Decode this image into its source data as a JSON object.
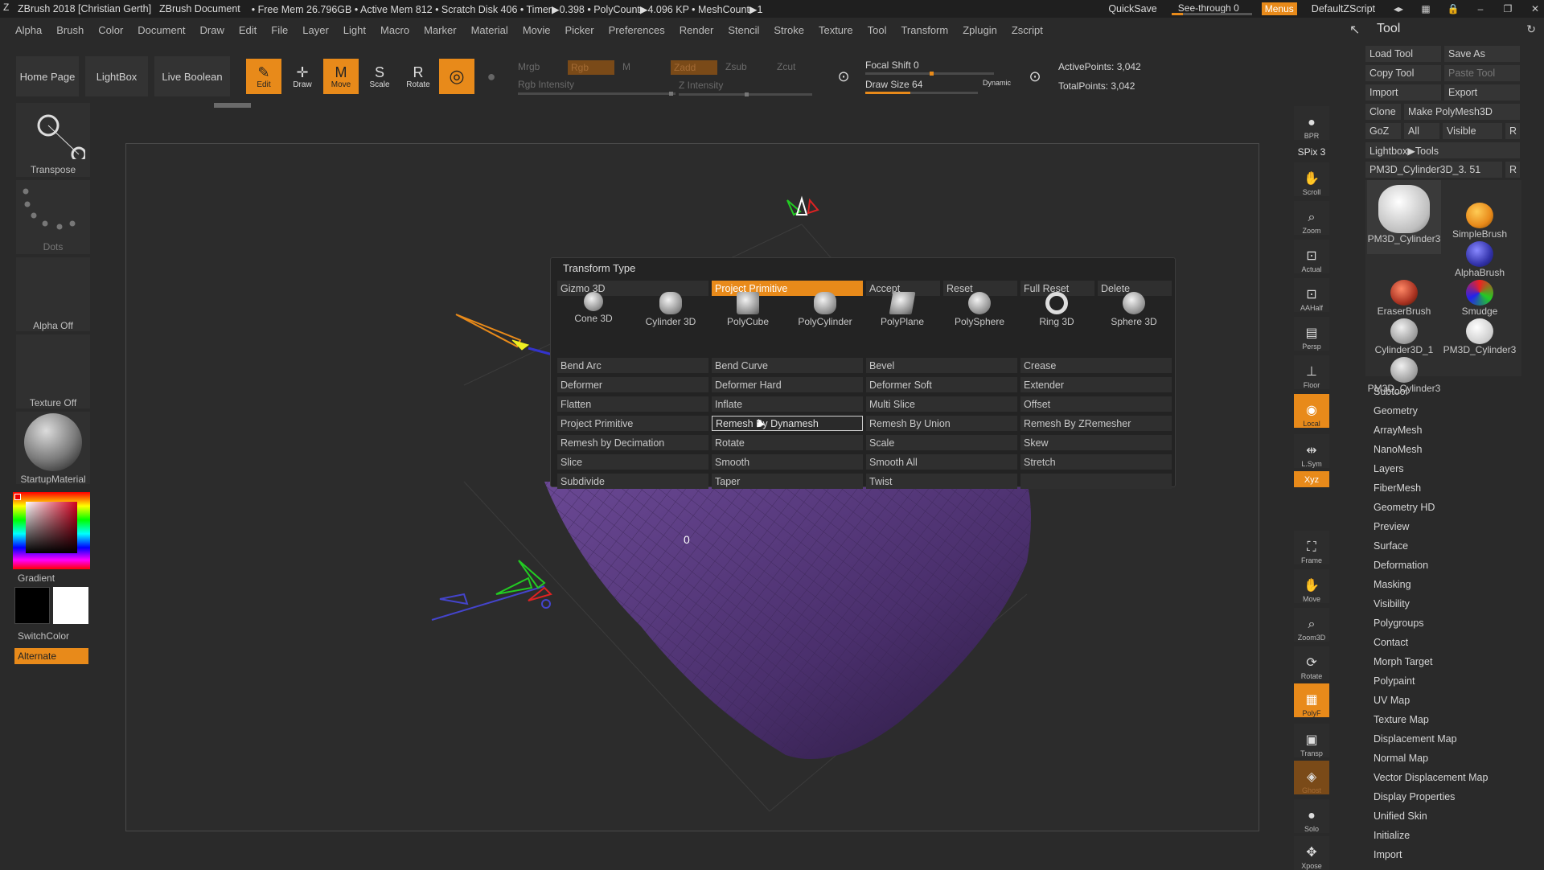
{
  "titlebar": {
    "title": "ZBrush 2018 [Christian Gerth]",
    "document": "ZBrush Document",
    "stats": "• Free Mem 26.796GB • Active Mem 812 • Scratch Disk 406 • Timer▶0.398 • PolyCount▶4.096 KP • MeshCount▶1",
    "quicksave": "QuickSave",
    "seethrough": "See-through  0",
    "menus": "Menus",
    "zscript": "DefaultZScript"
  },
  "menubar": [
    "Alpha",
    "Brush",
    "Color",
    "Document",
    "Draw",
    "Edit",
    "File",
    "Layer",
    "Light",
    "Macro",
    "Marker",
    "Material",
    "Movie",
    "Picker",
    "Preferences",
    "Render",
    "Stencil",
    "Stroke",
    "Texture",
    "Tool",
    "Transform",
    "Zplugin",
    "Zscript"
  ],
  "toolbar": {
    "home": "Home Page",
    "lightbox": "LightBox",
    "liveboolean": "Live Boolean",
    "edit": "Edit",
    "draw": "Draw",
    "move": "Move",
    "scale": "Scale",
    "rotate": "Rotate",
    "mrgb": "Mrgb",
    "rgb": "Rgb",
    "m": "M",
    "zadd": "Zadd",
    "zsub": "Zsub",
    "zcut": "Zcut",
    "rgb_intensity": "Rgb Intensity",
    "z_intensity": "Z Intensity",
    "focal_shift": "Focal Shift 0",
    "draw_size": "Draw Size 64",
    "dynamic": "Dynamic",
    "active_points": "ActivePoints: 3,042",
    "total_points": "TotalPoints: 3,042"
  },
  "left_shelf": {
    "transpose": "Transpose",
    "dots": "Dots",
    "alpha": "Alpha Off",
    "texture": "Texture Off",
    "material": "StartupMaterial",
    "gradient": "Gradient",
    "switchcolor": "SwitchColor",
    "alternate": "Alternate"
  },
  "viewport": {
    "label_zero": "0"
  },
  "popup": {
    "title": "Transform Type",
    "header": [
      "Gizmo 3D",
      "Project Primitive",
      "Accept",
      "Reset",
      "Full Reset",
      "Delete"
    ],
    "primitives": [
      "Cone 3D",
      "Cylinder 3D",
      "PolyCube",
      "PolyCylinder",
      "PolyPlane",
      "PolySphere",
      "Ring 3D",
      "Sphere 3D"
    ],
    "rows": [
      [
        "Bend Arc",
        "Bend Curve",
        "Bevel",
        "Crease"
      ],
      [
        "Deformer",
        "Deformer Hard",
        "Deformer Soft",
        "Extender"
      ],
      [
        "Flatten",
        "Inflate",
        "Multi Slice",
        "Offset"
      ],
      [
        "Project Primitive",
        "Remesh By Dynamesh",
        "Remesh By Union",
        "Remesh By ZRemesher"
      ],
      [
        "Remesh by Decimation",
        "Rotate",
        "Scale",
        "Skew"
      ],
      [
        "Slice",
        "Smooth",
        "Smooth All",
        "Stretch"
      ],
      [
        "Subdivide",
        "Taper",
        "Twist",
        ""
      ]
    ]
  },
  "right_dock": {
    "bpr": "BPR",
    "spix": "SPix 3",
    "scroll": "Scroll",
    "zoom": "Zoom",
    "actual": "Actual",
    "aahalf": "AAHalf",
    "persp": "Persp",
    "floor": "Floor",
    "local": "Local",
    "lsym": "L.Sym",
    "xyz": "Xyz",
    "frame": "Frame",
    "move": "Move",
    "zoom3d": "Zoom3D",
    "rotate": "Rotate",
    "polyf": "PolyF",
    "transp": "Transp",
    "ghost": "Ghost",
    "solo": "Solo",
    "xpose": "Xpose"
  },
  "tool_palette": {
    "title": "Tool",
    "load": "Load Tool",
    "saveas": "Save As",
    "copy": "Copy Tool",
    "paste": "Paste Tool",
    "import": "Import",
    "export": "Export",
    "clone": "Clone",
    "makepoly": "Make PolyMesh3D",
    "goz": "GoZ",
    "all": "All",
    "visible": "Visible",
    "r": "R",
    "lightbox_tools": "Lightbox▶Tools",
    "current_tool": "PM3D_Cylinder3D_3. 51",
    "thumbs": [
      "PM3D_Cylinder3",
      "SimpleBrush",
      "AlphaBrush",
      "EraserBrush",
      "Smudge",
      "Cylinder3D_1",
      "PM3D_Cylinder3",
      "PM3D_Cylinder3"
    ],
    "subpalettes": [
      "Subtool",
      "Geometry",
      "ArrayMesh",
      "NanoMesh",
      "Layers",
      "FiberMesh",
      "Geometry HD",
      "Preview",
      "Surface",
      "Deformation",
      "Masking",
      "Visibility",
      "Polygroups",
      "Contact",
      "Morph Target",
      "Polypaint",
      "UV Map",
      "Texture Map",
      "Displacement Map",
      "Normal Map",
      "Vector Displacement Map",
      "Display Properties",
      "Unified Skin",
      "Initialize",
      "Import"
    ]
  },
  "colors": {
    "accent": "#e88a1a",
    "mesh": "#5a3a80"
  }
}
